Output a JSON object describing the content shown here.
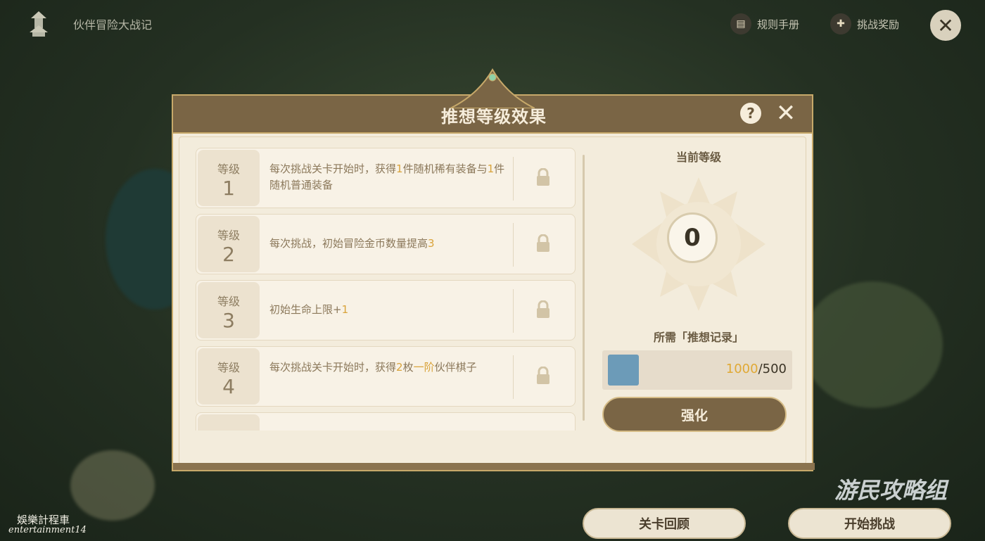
{
  "topbar": {
    "title": "伙伴冒险大战记",
    "rulebook_label": "规则手册",
    "rewards_label": "挑战奖励"
  },
  "dialog": {
    "title": "推想等级效果",
    "levels": [
      {
        "label": "等级",
        "num": "1",
        "text_parts": [
          "每次挑战关卡开始时，获得",
          "1",
          "件随机稀有装备与",
          "1",
          "件随机普通装备"
        ]
      },
      {
        "label": "等级",
        "num": "2",
        "text_parts": [
          "每次挑战，初始冒险金币数量提高",
          "3"
        ]
      },
      {
        "label": "等级",
        "num": "3",
        "text_parts": [
          "初始生命上限+",
          "1"
        ]
      },
      {
        "label": "等级",
        "num": "4",
        "text_parts": [
          "每次挑战关卡开始时，获得",
          "2",
          "枚",
          "一阶",
          "伙伴棋子"
        ]
      }
    ],
    "current_level_label": "当前等级",
    "current_level": "0",
    "required_label": "所需「推想记录」",
    "have_count": "1000",
    "need_count": "/500",
    "enhance_label": "强化"
  },
  "bottom": {
    "review_label": "关卡回顾",
    "start_label": "开始挑战"
  },
  "watermark": "游民攻略组",
  "credit_cn": "娛樂計程車",
  "credit_en": "entertainment14"
}
